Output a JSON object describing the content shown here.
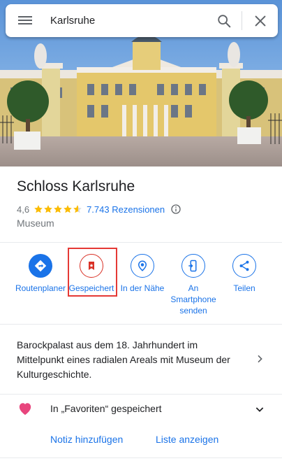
{
  "search": {
    "value": "Karlsruhe"
  },
  "place": {
    "title": "Schloss Karlsruhe",
    "rating": "4,6",
    "stars": 4.6,
    "reviews": "7.743 Rezensionen",
    "category": "Museum"
  },
  "actions": [
    {
      "label": "Routenplaner",
      "icon": "directions-icon"
    },
    {
      "label": "Gespeichert",
      "icon": "saved-bookmark-icon"
    },
    {
      "label": "In der Nähe",
      "icon": "nearby-icon"
    },
    {
      "label": "An Smartphone senden",
      "icon": "send-to-phone-icon"
    },
    {
      "label": "Teilen",
      "icon": "share-icon"
    }
  ],
  "description": "Barockpalast aus dem 18. Jahrhundert im Mittelpunkt eines radialen Areals mit Museum der Kulturgeschichte.",
  "saved": {
    "text": "In „Favoriten“ gespeichert",
    "add_note": "Notiz hinzufügen",
    "show_list": "Liste anzeigen"
  },
  "colors": {
    "accent": "#1a73e8",
    "saved": "#d93025",
    "star": "#fbbc04",
    "heart": "#e8457d",
    "highlight": "#e53935"
  }
}
